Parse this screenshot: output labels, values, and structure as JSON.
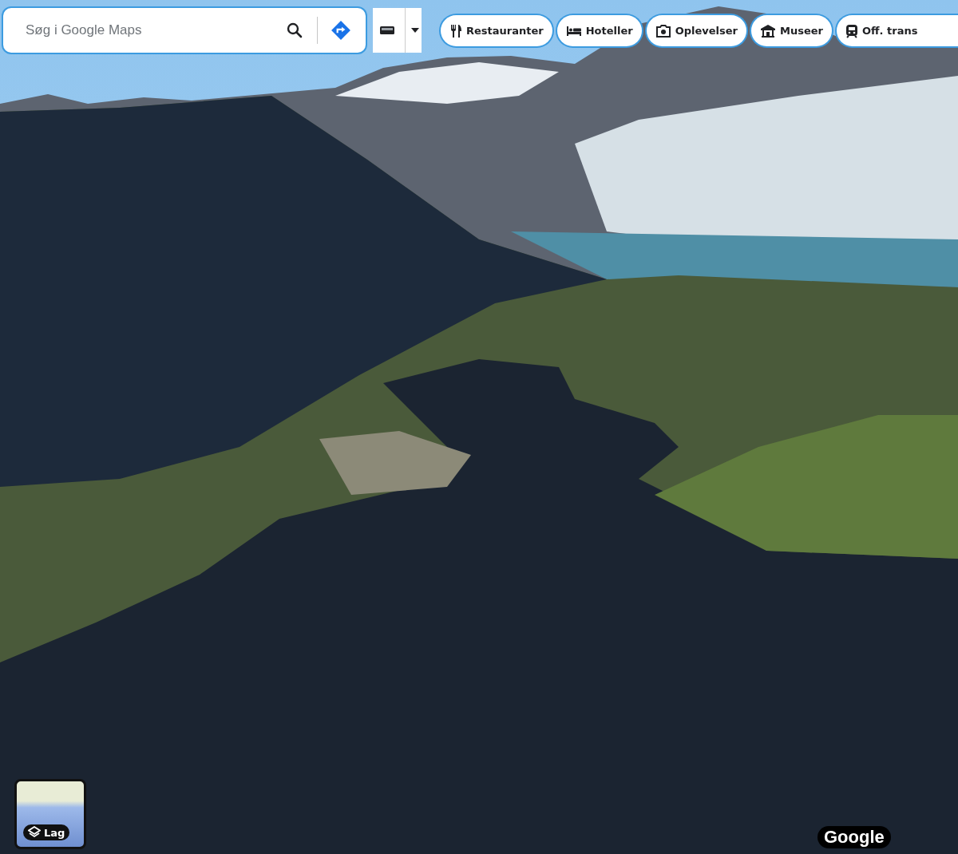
{
  "search": {
    "placeholder": "Søg i Google Maps"
  },
  "categories": [
    {
      "kind": "restaurant",
      "label": "Restauranter"
    },
    {
      "kind": "hotel",
      "label": "Hoteller"
    },
    {
      "kind": "camera",
      "label": "Oplevelser"
    },
    {
      "kind": "museum",
      "label": "Museer"
    },
    {
      "kind": "transit",
      "label": "Off. trans"
    }
  ],
  "layers": {
    "label": "Lag"
  },
  "attribution": "Google"
}
